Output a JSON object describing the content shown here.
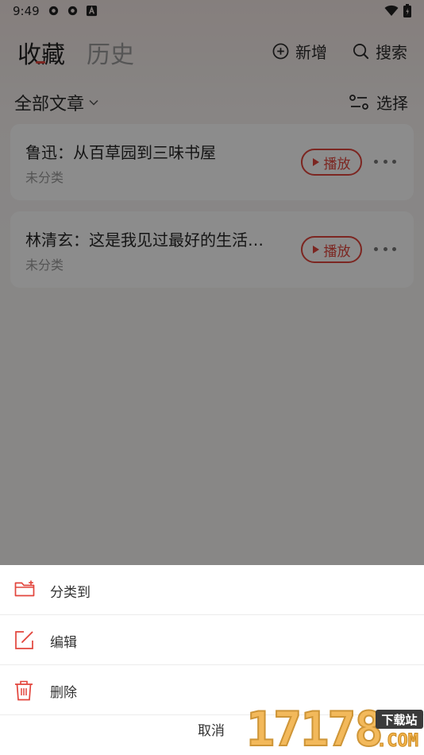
{
  "status_bar": {
    "time": "9:49",
    "icons": [
      "gear-icon",
      "gear-icon",
      "text-a-icon",
      "wifi-icon",
      "battery-icon"
    ]
  },
  "header": {
    "tabs": [
      {
        "label": "收藏",
        "active": true
      },
      {
        "label": "历史",
        "active": false
      }
    ],
    "add_label": "新增",
    "search_label": "搜索"
  },
  "filter": {
    "selected": "全部文章",
    "select_label": "选择"
  },
  "articles": [
    {
      "title": "鲁迅：从百草园到三味书屋",
      "category": "未分类",
      "play_label": "播放"
    },
    {
      "title": "林清玄：这是我见过最好的生活…",
      "category": "未分类",
      "play_label": "播放"
    }
  ],
  "sheet": {
    "items": [
      {
        "label": "分类到",
        "icon": "folder-add-icon"
      },
      {
        "label": "编辑",
        "icon": "edit-icon"
      },
      {
        "label": "删除",
        "icon": "trash-icon"
      }
    ],
    "cancel_label": "取消"
  },
  "watermark": {
    "number": "17178",
    "badge": "下载站",
    "domain": ".COM"
  },
  "colors": {
    "accent": "#e2453c",
    "overlay": "rgba(0,0,0,0.45)"
  }
}
